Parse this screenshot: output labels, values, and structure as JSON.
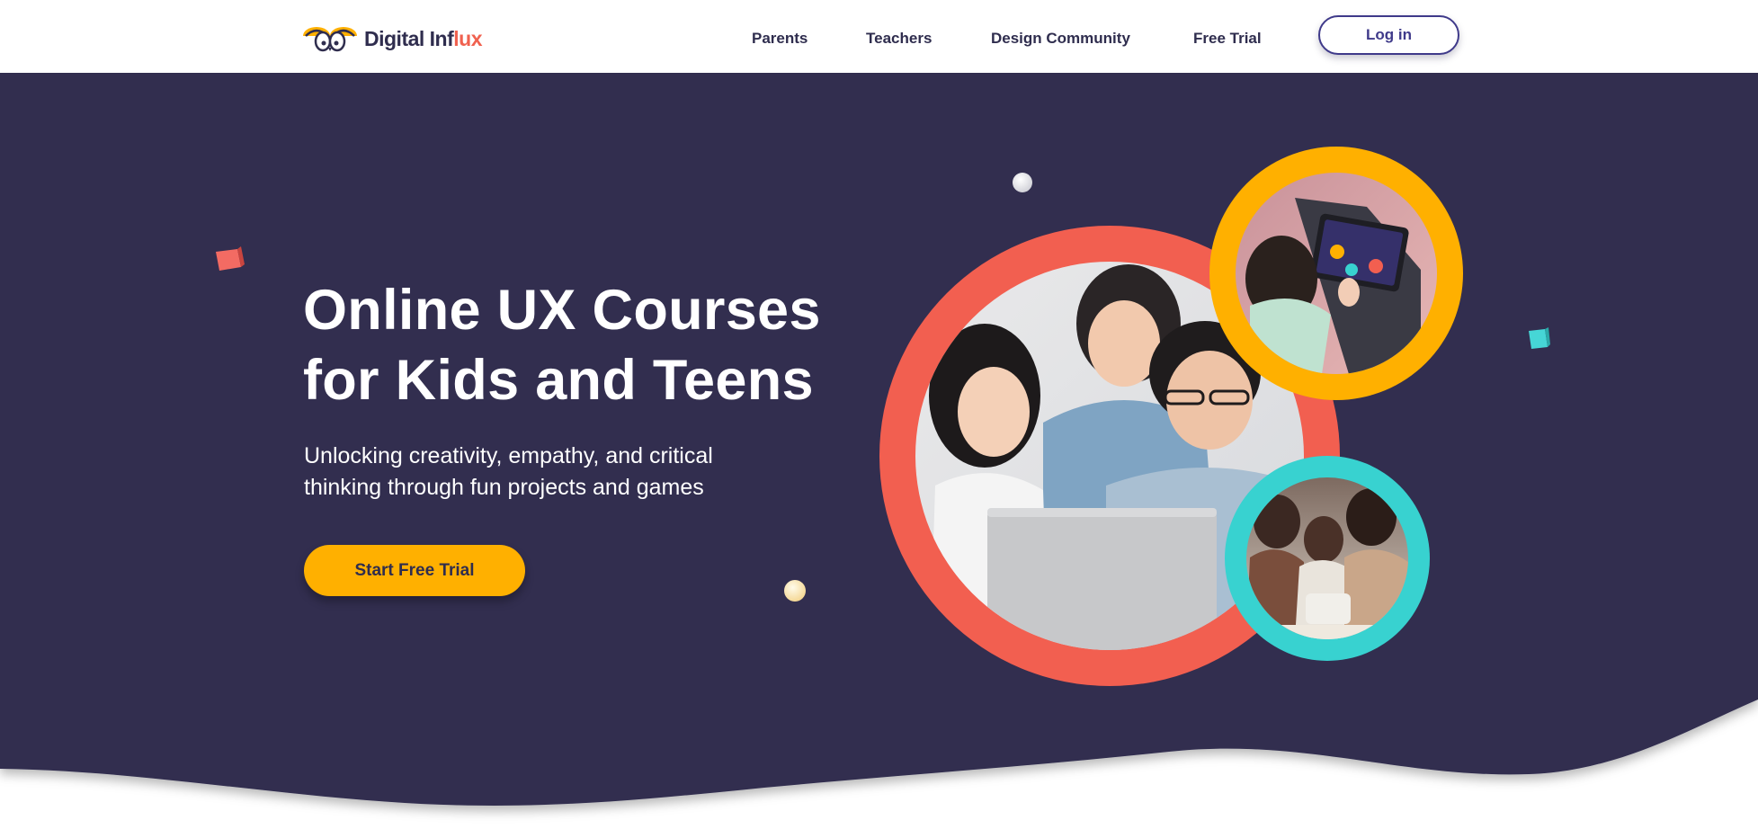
{
  "brand": {
    "name_main": "Digital Inf",
    "name_accent": "lux",
    "colors": {
      "navy": "#302e4f",
      "coral": "#f25f50",
      "yellow": "#ffb000",
      "teal": "#38d2d0",
      "login": "#3f3a8a"
    }
  },
  "nav": {
    "items": [
      {
        "label": "Parents"
      },
      {
        "label": "Teachers"
      },
      {
        "label": "Design Community"
      },
      {
        "label": "Free Trial"
      }
    ],
    "login_label": "Log in"
  },
  "hero": {
    "headline_line1": "Online UX Courses",
    "headline_line2": "for Kids and Teens",
    "sub_line1": "Unlocking creativity, empathy, and critical",
    "sub_line2": "thinking through fun projects and games",
    "cta_label": "Start Free Trial"
  },
  "images": {
    "main_photo": "family-laptop-photo",
    "top_photo": "child-tablet-photo",
    "bottom_photo": "family-tablet-photo"
  }
}
